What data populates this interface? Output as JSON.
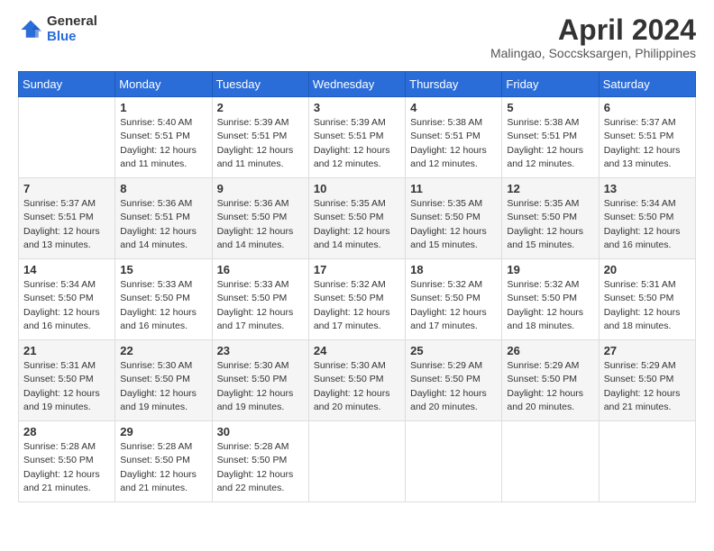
{
  "header": {
    "logo_general": "General",
    "logo_blue": "Blue",
    "month_title": "April 2024",
    "location": "Malingao, Soccsksargen, Philippines"
  },
  "calendar": {
    "days_of_week": [
      "Sunday",
      "Monday",
      "Tuesday",
      "Wednesday",
      "Thursday",
      "Friday",
      "Saturday"
    ],
    "weeks": [
      [
        {
          "day": "",
          "detail": ""
        },
        {
          "day": "1",
          "detail": "Sunrise: 5:40 AM\nSunset: 5:51 PM\nDaylight: 12 hours\nand 11 minutes."
        },
        {
          "day": "2",
          "detail": "Sunrise: 5:39 AM\nSunset: 5:51 PM\nDaylight: 12 hours\nand 11 minutes."
        },
        {
          "day": "3",
          "detail": "Sunrise: 5:39 AM\nSunset: 5:51 PM\nDaylight: 12 hours\nand 12 minutes."
        },
        {
          "day": "4",
          "detail": "Sunrise: 5:38 AM\nSunset: 5:51 PM\nDaylight: 12 hours\nand 12 minutes."
        },
        {
          "day": "5",
          "detail": "Sunrise: 5:38 AM\nSunset: 5:51 PM\nDaylight: 12 hours\nand 12 minutes."
        },
        {
          "day": "6",
          "detail": "Sunrise: 5:37 AM\nSunset: 5:51 PM\nDaylight: 12 hours\nand 13 minutes."
        }
      ],
      [
        {
          "day": "7",
          "detail": "Sunrise: 5:37 AM\nSunset: 5:51 PM\nDaylight: 12 hours\nand 13 minutes."
        },
        {
          "day": "8",
          "detail": "Sunrise: 5:36 AM\nSunset: 5:51 PM\nDaylight: 12 hours\nand 14 minutes."
        },
        {
          "day": "9",
          "detail": "Sunrise: 5:36 AM\nSunset: 5:50 PM\nDaylight: 12 hours\nand 14 minutes."
        },
        {
          "day": "10",
          "detail": "Sunrise: 5:35 AM\nSunset: 5:50 PM\nDaylight: 12 hours\nand 14 minutes."
        },
        {
          "day": "11",
          "detail": "Sunrise: 5:35 AM\nSunset: 5:50 PM\nDaylight: 12 hours\nand 15 minutes."
        },
        {
          "day": "12",
          "detail": "Sunrise: 5:35 AM\nSunset: 5:50 PM\nDaylight: 12 hours\nand 15 minutes."
        },
        {
          "day": "13",
          "detail": "Sunrise: 5:34 AM\nSunset: 5:50 PM\nDaylight: 12 hours\nand 16 minutes."
        }
      ],
      [
        {
          "day": "14",
          "detail": "Sunrise: 5:34 AM\nSunset: 5:50 PM\nDaylight: 12 hours\nand 16 minutes."
        },
        {
          "day": "15",
          "detail": "Sunrise: 5:33 AM\nSunset: 5:50 PM\nDaylight: 12 hours\nand 16 minutes."
        },
        {
          "day": "16",
          "detail": "Sunrise: 5:33 AM\nSunset: 5:50 PM\nDaylight: 12 hours\nand 17 minutes."
        },
        {
          "day": "17",
          "detail": "Sunrise: 5:32 AM\nSunset: 5:50 PM\nDaylight: 12 hours\nand 17 minutes."
        },
        {
          "day": "18",
          "detail": "Sunrise: 5:32 AM\nSunset: 5:50 PM\nDaylight: 12 hours\nand 17 minutes."
        },
        {
          "day": "19",
          "detail": "Sunrise: 5:32 AM\nSunset: 5:50 PM\nDaylight: 12 hours\nand 18 minutes."
        },
        {
          "day": "20",
          "detail": "Sunrise: 5:31 AM\nSunset: 5:50 PM\nDaylight: 12 hours\nand 18 minutes."
        }
      ],
      [
        {
          "day": "21",
          "detail": "Sunrise: 5:31 AM\nSunset: 5:50 PM\nDaylight: 12 hours\nand 19 minutes."
        },
        {
          "day": "22",
          "detail": "Sunrise: 5:30 AM\nSunset: 5:50 PM\nDaylight: 12 hours\nand 19 minutes."
        },
        {
          "day": "23",
          "detail": "Sunrise: 5:30 AM\nSunset: 5:50 PM\nDaylight: 12 hours\nand 19 minutes."
        },
        {
          "day": "24",
          "detail": "Sunrise: 5:30 AM\nSunset: 5:50 PM\nDaylight: 12 hours\nand 20 minutes."
        },
        {
          "day": "25",
          "detail": "Sunrise: 5:29 AM\nSunset: 5:50 PM\nDaylight: 12 hours\nand 20 minutes."
        },
        {
          "day": "26",
          "detail": "Sunrise: 5:29 AM\nSunset: 5:50 PM\nDaylight: 12 hours\nand 20 minutes."
        },
        {
          "day": "27",
          "detail": "Sunrise: 5:29 AM\nSunset: 5:50 PM\nDaylight: 12 hours\nand 21 minutes."
        }
      ],
      [
        {
          "day": "28",
          "detail": "Sunrise: 5:28 AM\nSunset: 5:50 PM\nDaylight: 12 hours\nand 21 minutes."
        },
        {
          "day": "29",
          "detail": "Sunrise: 5:28 AM\nSunset: 5:50 PM\nDaylight: 12 hours\nand 21 minutes."
        },
        {
          "day": "30",
          "detail": "Sunrise: 5:28 AM\nSunset: 5:50 PM\nDaylight: 12 hours\nand 22 minutes."
        },
        {
          "day": "",
          "detail": ""
        },
        {
          "day": "",
          "detail": ""
        },
        {
          "day": "",
          "detail": ""
        },
        {
          "day": "",
          "detail": ""
        }
      ]
    ]
  }
}
